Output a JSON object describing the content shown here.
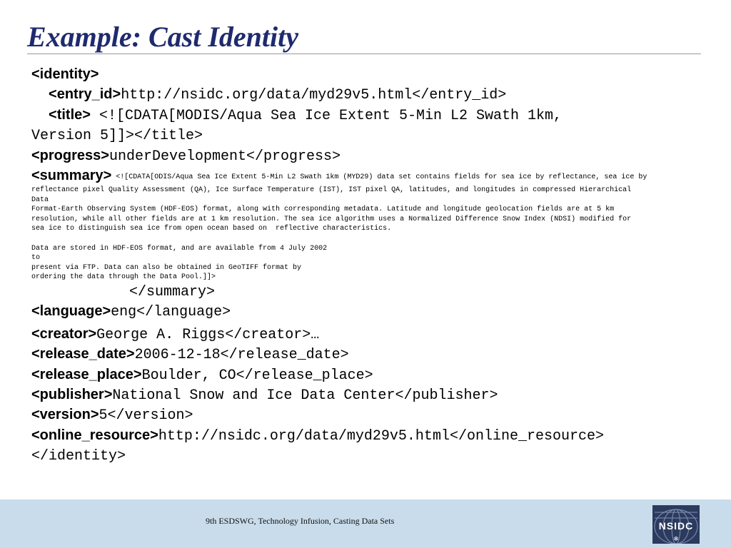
{
  "slide": {
    "title": "Example: Cast Identity",
    "lines": [
      {
        "indent": "",
        "tag": "<identity>",
        "text": ""
      },
      {
        "indent": "  ",
        "tag": "<entry_id>",
        "text": "http://nsidc.org/data/myd29v5.html</entry_id>"
      },
      {
        "indent": "  ",
        "tag": "<title>",
        "text": " <![CDATA[MODIS/Aqua Sea Ice Extent 5-Min L2 Swath 1km,"
      },
      {
        "indent": "",
        "tag": "",
        "text": "Version 5]]></title>"
      },
      {
        "indent": "",
        "tag": "<progress>",
        "text": "underDevelopment</progress>"
      }
    ],
    "summary_tag": "<summary>",
    "summary_first": " <![CDATA[ODIS/Aqua Sea Ice Extent 5-Min L2 Swath 1km (MYD29) data set contains fields for sea ice by reflectance, sea ice by",
    "summary_body": "reflectance pixel Quality Assessment (QA), Ice Surface Temperature (IST), IST pixel QA, latitudes, and longitudes in compressed Hierarchical\nData\nFormat-Earth Observing System (HDF-EOS) format, along with corresponding metadata. Latitude and longitude geolocation fields are at 5 km\nresolution, while all other fields are at 1 km resolution. The sea ice algorithm uses a Normalized Difference Snow Index (NDSI) modified for\nsea ice to distinguish sea ice from open ocean based on  reflective characteristics.\n\nData are stored in HDF-EOS format, and are available from 4 July 2002\nto\npresent via FTP. Data can also be obtained in GeoTIFF format by\nordering the data through the Data Pool.]]>",
    "summary_close": "</summary>",
    "lines2": [
      {
        "indent": "",
        "tag": "<language>",
        "text": "eng</language>"
      },
      {
        "indent": "",
        "tag": "<creator>",
        "text": "George A. Riggs</creator>…"
      },
      {
        "indent": "",
        "tag": "<release_date>",
        "text": "2006-12-18</release_date>"
      },
      {
        "indent": "",
        "tag": "<release_place>",
        "text": "Boulder, CO</release_place>"
      },
      {
        "indent": "",
        "tag": "<publisher>",
        "text": "National Snow and Ice Data Center</publisher>"
      },
      {
        "indent": "",
        "tag": "<version>",
        "text": "5</version>"
      },
      {
        "indent": "",
        "tag": "<online_resource>",
        "text": "http://nsidc.org/data/myd29v5.html</online_resource>"
      },
      {
        "indent": "",
        "tag": "",
        "text": "</identity>"
      }
    ]
  },
  "footer": {
    "text": "9th ESDSWG, Technology Infusion, Casting Data Sets",
    "logo": "NSIDC",
    "logo_icon": "globe-icon"
  },
  "colors": {
    "title": "#1f2a6e",
    "footer_bg": "#c9dceb",
    "logo_bg": "#2c3a5e"
  }
}
